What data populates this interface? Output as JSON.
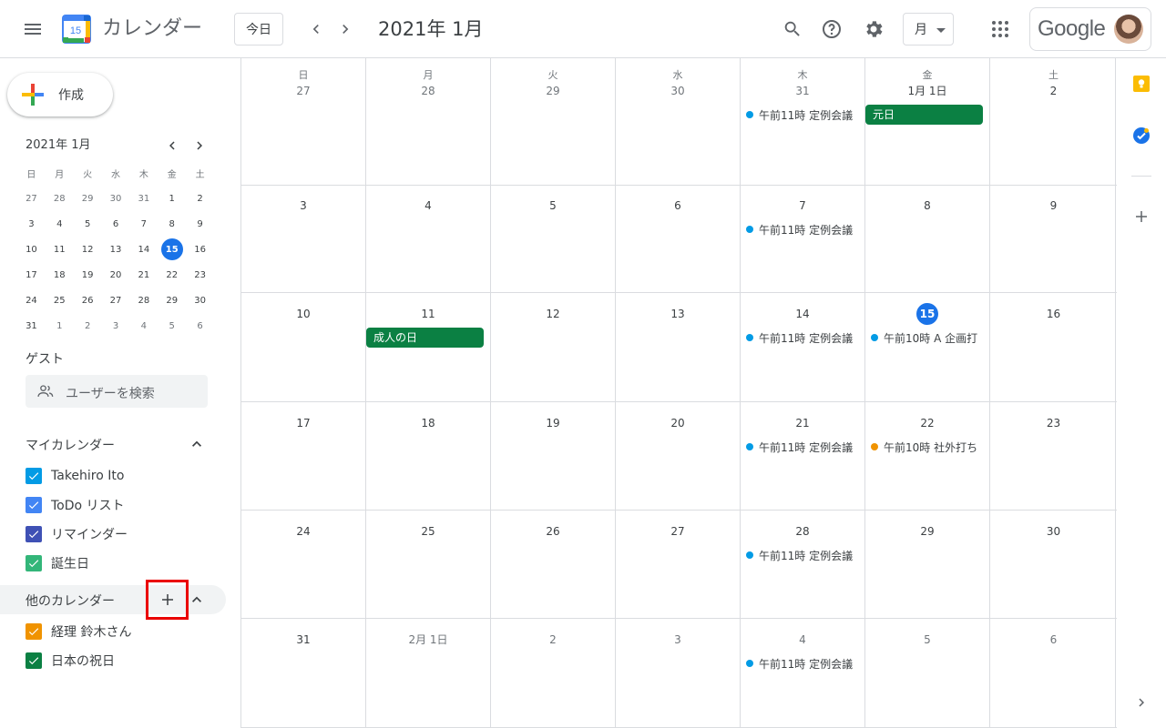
{
  "header": {
    "app_title": "カレンダー",
    "logo_day": "15",
    "today_label": "今日",
    "month_title": "2021年 1月",
    "view_label": "月",
    "google_label": "Google"
  },
  "create": {
    "label": "作成"
  },
  "mini_calendar": {
    "title": "2021年 1月",
    "dows": [
      "日",
      "月",
      "火",
      "水",
      "木",
      "金",
      "土"
    ],
    "weeks": [
      [
        "27",
        "28",
        "29",
        "30",
        "31",
        "1",
        "2"
      ],
      [
        "3",
        "4",
        "5",
        "6",
        "7",
        "8",
        "9"
      ],
      [
        "10",
        "11",
        "12",
        "13",
        "14",
        "15",
        "16"
      ],
      [
        "17",
        "18",
        "19",
        "20",
        "21",
        "22",
        "23"
      ],
      [
        "24",
        "25",
        "26",
        "27",
        "28",
        "29",
        "30"
      ],
      [
        "31",
        "1",
        "2",
        "3",
        "4",
        "5",
        "6"
      ]
    ]
  },
  "guest": {
    "label": "ゲスト",
    "placeholder": "ユーザーを検索"
  },
  "my_calendars": {
    "title": "マイカレンダー",
    "items": [
      {
        "name": "Takehiro Ito",
        "color": "#039be5"
      },
      {
        "name": "ToDo リスト",
        "color": "#4285f4"
      },
      {
        "name": "リマインダー",
        "color": "#3f51b5"
      },
      {
        "name": "誕生日",
        "color": "#33b679"
      }
    ]
  },
  "other_calendars": {
    "title": "他のカレンダー",
    "items": [
      {
        "name": "経理 鈴木さん",
        "color": "#f09300"
      },
      {
        "name": "日本の祝日",
        "color": "#0b8043"
      }
    ]
  },
  "month_grid": {
    "dows": [
      "日",
      "月",
      "火",
      "水",
      "木",
      "金",
      "土"
    ],
    "weeks": [
      [
        "27",
        "28",
        "29",
        "30",
        "31",
        "1月 1日",
        "2"
      ],
      [
        "3",
        "4",
        "5",
        "6",
        "7",
        "8",
        "9"
      ],
      [
        "10",
        "11",
        "12",
        "13",
        "14",
        "15",
        "16"
      ],
      [
        "17",
        "18",
        "19",
        "20",
        "21",
        "22",
        "23"
      ],
      [
        "24",
        "25",
        "26",
        "27",
        "28",
        "29",
        "30"
      ],
      [
        "31",
        "2月 1日",
        "2",
        "3",
        "4",
        "5",
        "6"
      ]
    ],
    "events": [
      {
        "week": 0,
        "day": 4,
        "type": "dot",
        "text": "午前11時 定例会議",
        "color": "#039be5"
      },
      {
        "week": 0,
        "day": 5,
        "type": "bar",
        "text": "元日",
        "color": "#0b8043"
      },
      {
        "week": 1,
        "day": 4,
        "type": "dot",
        "text": "午前11時 定例会議",
        "color": "#039be5"
      },
      {
        "week": 2,
        "day": 1,
        "type": "bar",
        "text": "成人の日",
        "color": "#0b8043"
      },
      {
        "week": 2,
        "day": 4,
        "type": "dot",
        "text": "午前11時 定例会議",
        "color": "#039be5"
      },
      {
        "week": 2,
        "day": 5,
        "type": "dot",
        "text": "午前10時 A 企画打",
        "color": "#039be5"
      },
      {
        "week": 3,
        "day": 4,
        "type": "dot",
        "text": "午前11時 定例会議",
        "color": "#039be5"
      },
      {
        "week": 3,
        "day": 5,
        "type": "dot",
        "text": "午前10時 社外打ち",
        "color": "#f09300"
      },
      {
        "week": 4,
        "day": 4,
        "type": "dot",
        "text": "午前11時 定例会議",
        "color": "#039be5"
      },
      {
        "week": 5,
        "day": 4,
        "type": "dot",
        "text": "午前11時 定例会議",
        "color": "#039be5"
      }
    ]
  },
  "colors": {
    "accent": "#1a73e8",
    "highlight": "#ea0000"
  }
}
